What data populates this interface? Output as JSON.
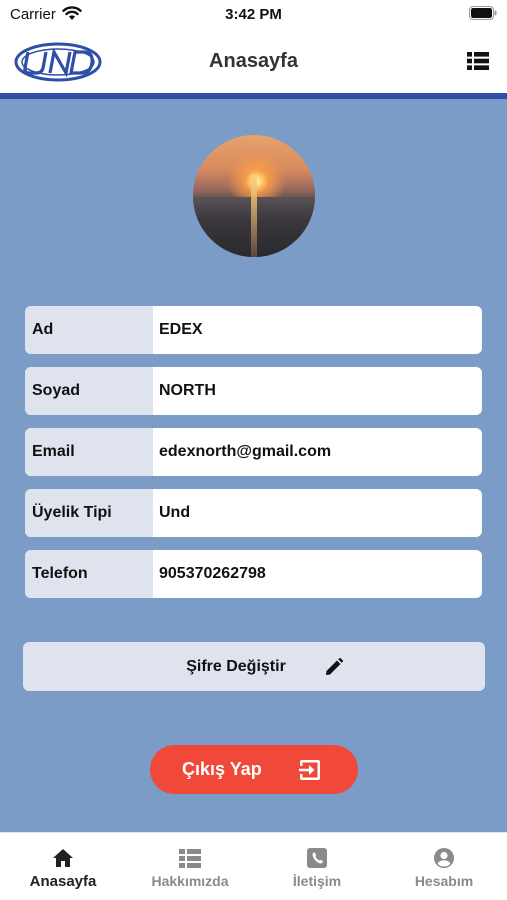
{
  "status_bar": {
    "carrier": "Carrier",
    "time": "3:42 PM"
  },
  "header": {
    "title": "Anasayfa",
    "logo_icon": "und-logo",
    "menu_icon": "list-icon"
  },
  "profile": {
    "avatar": "sunset-photo",
    "fields": [
      {
        "label": "Ad",
        "value": "EDEX"
      },
      {
        "label": "Soyad",
        "value": "NORTH"
      },
      {
        "label": "Email",
        "value": "edexnorth@gmail.com"
      },
      {
        "label": "Üyelik Tipi",
        "value": "Und"
      },
      {
        "label": "Telefon",
        "value": "905370262798"
      }
    ]
  },
  "actions": {
    "change_password_label": "Şifre Değiştir",
    "change_password_icon": "pencil-icon",
    "logout_label": "Çıkış Yap",
    "logout_icon": "exit-icon"
  },
  "tabs": [
    {
      "label": "Anasayfa",
      "icon": "home-icon",
      "active": true
    },
    {
      "label": "Hakkımızda",
      "icon": "list-icon",
      "active": false
    },
    {
      "label": "İletişim",
      "icon": "phone-icon",
      "active": false
    },
    {
      "label": "Hesabım",
      "icon": "user-icon",
      "active": false
    }
  ],
  "colors": {
    "accent": "#2f4ea8",
    "background": "#7a9cc6",
    "field_label_bg": "#dfe3ed",
    "logout": "#f0493a"
  }
}
